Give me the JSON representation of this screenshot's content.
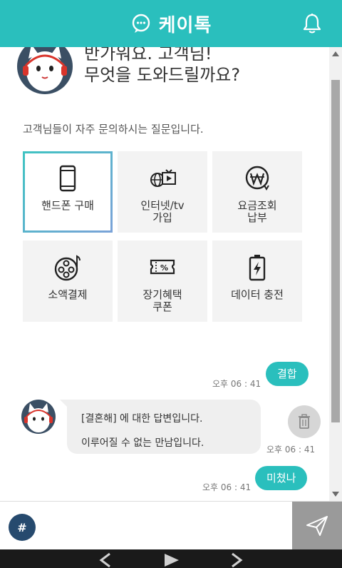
{
  "header": {
    "title": "케이톡",
    "title_icon": "chat-bubble-icon",
    "right_icon": "bell-icon"
  },
  "greeting": {
    "line1": "반가워요. 고객님!",
    "line2": "무엇을 도와드릴까요?"
  },
  "faq": {
    "intro": "고객님들이 자주 문의하시는 질문입니다.",
    "tiles": [
      {
        "label": "핸드폰 구매",
        "icon": "smartphone-icon",
        "selected": true
      },
      {
        "label": "인터넷/tv\n가입",
        "icon": "internet-tv-icon",
        "selected": false
      },
      {
        "label": "요금조회\n납부",
        "icon": "won-payment-icon",
        "selected": false
      },
      {
        "label": "소액결제",
        "icon": "film-reel-icon",
        "selected": false
      },
      {
        "label": "장기혜택\n쿠폰",
        "icon": "coupon-icon",
        "selected": false
      },
      {
        "label": "데이터 충전",
        "icon": "battery-charge-icon",
        "selected": false
      }
    ]
  },
  "messages": [
    {
      "from": "user",
      "text": "결합",
      "time": "오후 06 : 41"
    },
    {
      "from": "bot",
      "line1": "[결혼해] 에 대한 답변입니다.",
      "line2": "이루어질 수 없는 만남입니다.",
      "time": "오후 06 : 41"
    },
    {
      "from": "user",
      "text": "미쳤나",
      "time": "오후 06 : 41"
    }
  ],
  "input": {
    "hash_label": "#",
    "placeholder": "",
    "value": ""
  },
  "colors": {
    "accent": "#2abfbd",
    "hash_button": "#264a6e",
    "send_button": "#9a9a9a"
  }
}
